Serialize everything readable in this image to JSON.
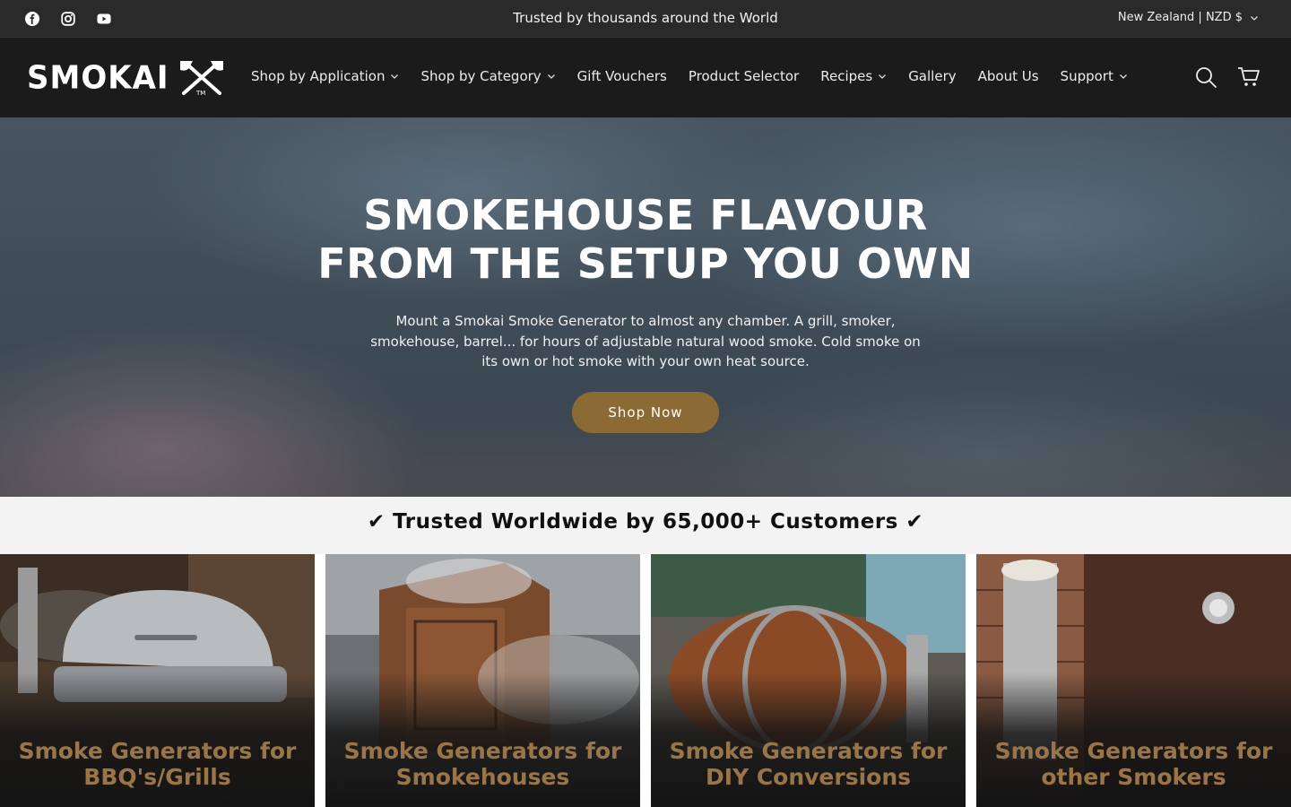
{
  "announcement": {
    "text": "Trusted by thousands around the World",
    "country_selector": "New Zealand | NZD $"
  },
  "social": [
    {
      "icon": "facebook-icon"
    },
    {
      "icon": "instagram-icon"
    },
    {
      "icon": "youtube-icon"
    }
  ],
  "header": {
    "logo_text": "SMOKAI",
    "logo_mark": "TM",
    "nav": [
      {
        "label": "Shop by Application",
        "dropdown": true
      },
      {
        "label": "Shop by Category",
        "dropdown": true
      },
      {
        "label": "Gift Vouchers",
        "dropdown": false
      },
      {
        "label": "Product Selector",
        "dropdown": false
      },
      {
        "label": "Recipes",
        "dropdown": true
      },
      {
        "label": "Gallery",
        "dropdown": false
      },
      {
        "label": "About Us",
        "dropdown": false
      },
      {
        "label": "Support",
        "dropdown": true
      }
    ],
    "icons": [
      "search-icon",
      "cart-icon"
    ]
  },
  "hero": {
    "title_line1": "SMOKEHOUSE FLAVOUR",
    "title_line2": "FROM THE SETUP YOU OWN",
    "body": "Mount a Smokai Smoke Generator to almost any chamber. A grill, smoker, smokehouse, barrel... for hours of adjustable natural wood smoke. Cold smoke on its own or hot smoke with your own heat source.",
    "cta": "Shop Now"
  },
  "trust_bar": {
    "text": "✔ Trusted Worldwide by 65,000+ Customers ✔"
  },
  "categories": [
    {
      "title": "Smoke Generators for BBQ's/Grills"
    },
    {
      "title": "Smoke Generators for Smokehouses"
    },
    {
      "title": "Smoke Generators for DIY Conversions"
    },
    {
      "title": "Smoke Generators for other Smokers"
    }
  ],
  "colors": {
    "accent": "#8b6a34",
    "tile_label": "#9a7546",
    "header_bg": "#1b1b1b",
    "topbar_bg": "#2a2a2a"
  }
}
